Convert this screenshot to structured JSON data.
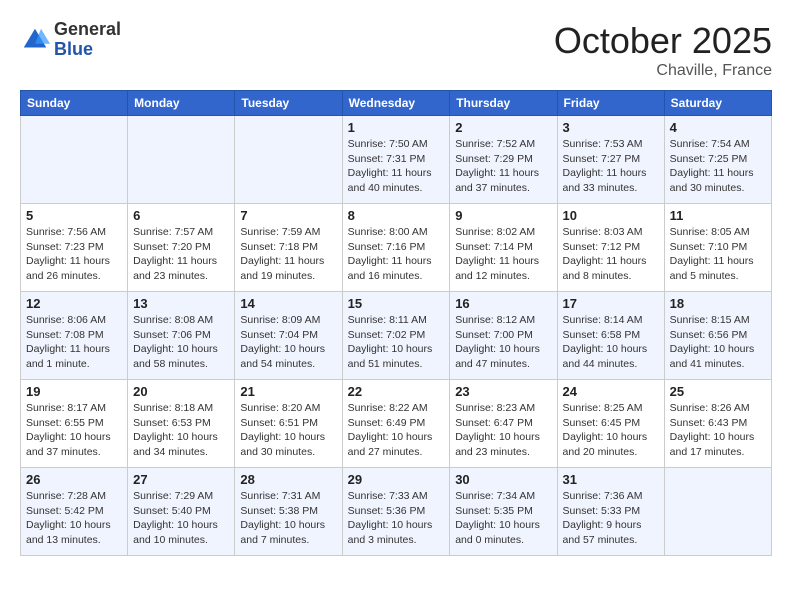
{
  "header": {
    "logo_general": "General",
    "logo_blue": "Blue",
    "month_title": "October 2025",
    "location": "Chaville, France"
  },
  "weekdays": [
    "Sunday",
    "Monday",
    "Tuesday",
    "Wednesday",
    "Thursday",
    "Friday",
    "Saturday"
  ],
  "weeks": [
    [
      {
        "day": "",
        "info": ""
      },
      {
        "day": "",
        "info": ""
      },
      {
        "day": "",
        "info": ""
      },
      {
        "day": "1",
        "info": "Sunrise: 7:50 AM\nSunset: 7:31 PM\nDaylight: 11 hours\nand 40 minutes."
      },
      {
        "day": "2",
        "info": "Sunrise: 7:52 AM\nSunset: 7:29 PM\nDaylight: 11 hours\nand 37 minutes."
      },
      {
        "day": "3",
        "info": "Sunrise: 7:53 AM\nSunset: 7:27 PM\nDaylight: 11 hours\nand 33 minutes."
      },
      {
        "day": "4",
        "info": "Sunrise: 7:54 AM\nSunset: 7:25 PM\nDaylight: 11 hours\nand 30 minutes."
      }
    ],
    [
      {
        "day": "5",
        "info": "Sunrise: 7:56 AM\nSunset: 7:23 PM\nDaylight: 11 hours\nand 26 minutes."
      },
      {
        "day": "6",
        "info": "Sunrise: 7:57 AM\nSunset: 7:20 PM\nDaylight: 11 hours\nand 23 minutes."
      },
      {
        "day": "7",
        "info": "Sunrise: 7:59 AM\nSunset: 7:18 PM\nDaylight: 11 hours\nand 19 minutes."
      },
      {
        "day": "8",
        "info": "Sunrise: 8:00 AM\nSunset: 7:16 PM\nDaylight: 11 hours\nand 16 minutes."
      },
      {
        "day": "9",
        "info": "Sunrise: 8:02 AM\nSunset: 7:14 PM\nDaylight: 11 hours\nand 12 minutes."
      },
      {
        "day": "10",
        "info": "Sunrise: 8:03 AM\nSunset: 7:12 PM\nDaylight: 11 hours\nand 8 minutes."
      },
      {
        "day": "11",
        "info": "Sunrise: 8:05 AM\nSunset: 7:10 PM\nDaylight: 11 hours\nand 5 minutes."
      }
    ],
    [
      {
        "day": "12",
        "info": "Sunrise: 8:06 AM\nSunset: 7:08 PM\nDaylight: 11 hours\nand 1 minute."
      },
      {
        "day": "13",
        "info": "Sunrise: 8:08 AM\nSunset: 7:06 PM\nDaylight: 10 hours\nand 58 minutes."
      },
      {
        "day": "14",
        "info": "Sunrise: 8:09 AM\nSunset: 7:04 PM\nDaylight: 10 hours\nand 54 minutes."
      },
      {
        "day": "15",
        "info": "Sunrise: 8:11 AM\nSunset: 7:02 PM\nDaylight: 10 hours\nand 51 minutes."
      },
      {
        "day": "16",
        "info": "Sunrise: 8:12 AM\nSunset: 7:00 PM\nDaylight: 10 hours\nand 47 minutes."
      },
      {
        "day": "17",
        "info": "Sunrise: 8:14 AM\nSunset: 6:58 PM\nDaylight: 10 hours\nand 44 minutes."
      },
      {
        "day": "18",
        "info": "Sunrise: 8:15 AM\nSunset: 6:56 PM\nDaylight: 10 hours\nand 41 minutes."
      }
    ],
    [
      {
        "day": "19",
        "info": "Sunrise: 8:17 AM\nSunset: 6:55 PM\nDaylight: 10 hours\nand 37 minutes."
      },
      {
        "day": "20",
        "info": "Sunrise: 8:18 AM\nSunset: 6:53 PM\nDaylight: 10 hours\nand 34 minutes."
      },
      {
        "day": "21",
        "info": "Sunrise: 8:20 AM\nSunset: 6:51 PM\nDaylight: 10 hours\nand 30 minutes."
      },
      {
        "day": "22",
        "info": "Sunrise: 8:22 AM\nSunset: 6:49 PM\nDaylight: 10 hours\nand 27 minutes."
      },
      {
        "day": "23",
        "info": "Sunrise: 8:23 AM\nSunset: 6:47 PM\nDaylight: 10 hours\nand 23 minutes."
      },
      {
        "day": "24",
        "info": "Sunrise: 8:25 AM\nSunset: 6:45 PM\nDaylight: 10 hours\nand 20 minutes."
      },
      {
        "day": "25",
        "info": "Sunrise: 8:26 AM\nSunset: 6:43 PM\nDaylight: 10 hours\nand 17 minutes."
      }
    ],
    [
      {
        "day": "26",
        "info": "Sunrise: 7:28 AM\nSunset: 5:42 PM\nDaylight: 10 hours\nand 13 minutes."
      },
      {
        "day": "27",
        "info": "Sunrise: 7:29 AM\nSunset: 5:40 PM\nDaylight: 10 hours\nand 10 minutes."
      },
      {
        "day": "28",
        "info": "Sunrise: 7:31 AM\nSunset: 5:38 PM\nDaylight: 10 hours\nand 7 minutes."
      },
      {
        "day": "29",
        "info": "Sunrise: 7:33 AM\nSunset: 5:36 PM\nDaylight: 10 hours\nand 3 minutes."
      },
      {
        "day": "30",
        "info": "Sunrise: 7:34 AM\nSunset: 5:35 PM\nDaylight: 10 hours\nand 0 minutes."
      },
      {
        "day": "31",
        "info": "Sunrise: 7:36 AM\nSunset: 5:33 PM\nDaylight: 9 hours\nand 57 minutes."
      },
      {
        "day": "",
        "info": ""
      }
    ]
  ]
}
